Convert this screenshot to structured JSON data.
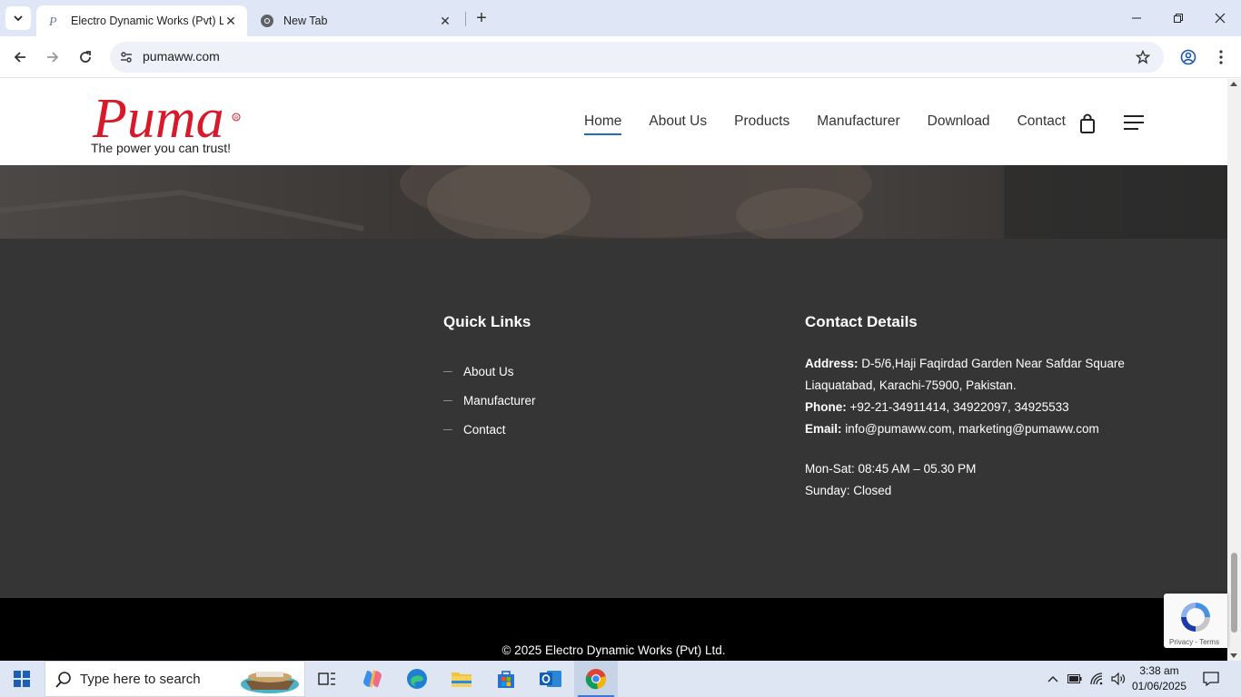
{
  "browser": {
    "tabs": [
      {
        "title": "Electro Dynamic Works (Pvt) Ltd",
        "active": true
      },
      {
        "title": "New Tab",
        "active": false
      }
    ],
    "url": "pumaww.com"
  },
  "site": {
    "logo_text": "Puma",
    "tagline": "The power you can trust!",
    "nav": [
      "Home",
      "About Us",
      "Products",
      "Manufacturer",
      "Download",
      "Contact"
    ],
    "active_nav": "Home"
  },
  "footer": {
    "quick_links": {
      "heading": "Quick Links",
      "items": [
        "About Us",
        "Manufacturer",
        "Contact"
      ]
    },
    "contact": {
      "heading": "Contact Details",
      "address_label": "Address:",
      "address_line1": "D-5/6,Haji Faqirdad Garden Near Safdar Square",
      "address_line2": "Liaquatabad, Karachi-75900, Pakistan.",
      "phone_label": "Phone:",
      "phone": "+92-21-34911414, 34922097, 34925533",
      "email_label": "Email:",
      "email": "info@pumaww.com, marketing@pumaww.com",
      "hours_weekdays": "Mon-Sat: 08:45 AM – 05.30 PM",
      "hours_sunday": "Sunday: Closed"
    },
    "copyright": "© 2025 Electro Dynamic Works (Pvt) Ltd."
  },
  "recaptcha": {
    "links": "Privacy - Terms"
  },
  "taskbar": {
    "search_placeholder": "Type here to search",
    "time": "3:38 am",
    "date": "01/06/2025"
  },
  "colors": {
    "accent": "#1d6fb5",
    "logo_red": "#d7192a",
    "footer_bg": "#353535",
    "copyright_bg": "#000000"
  }
}
